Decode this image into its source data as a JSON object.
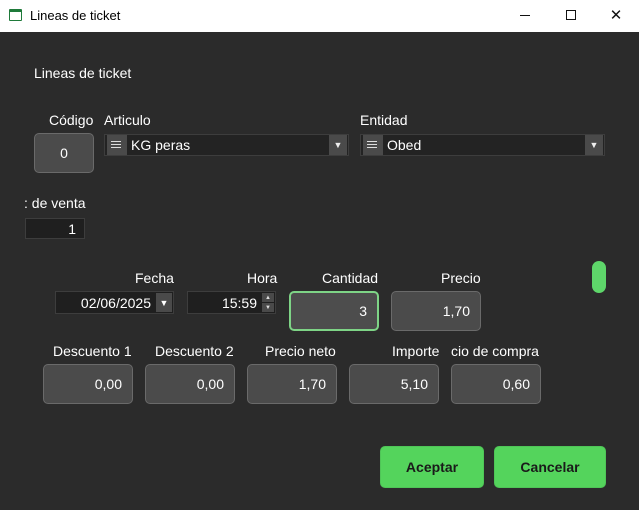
{
  "window": {
    "title": "Lineas de ticket",
    "icon": "window-icon",
    "controls": {
      "minimize": "minimize-icon",
      "maximize": "maximize-icon",
      "close": "close-icon"
    }
  },
  "section_title": "Lineas de ticket",
  "codigo": {
    "label": "Código",
    "value": "0"
  },
  "articulo": {
    "label": "Articulo",
    "value": "KG peras"
  },
  "entidad": {
    "label": "Entidad",
    "value": "Obed"
  },
  "tarifa": {
    "label": ": de venta",
    "value": "1"
  },
  "fecha": {
    "label": "Fecha",
    "value": "02/06/2025"
  },
  "hora": {
    "label": "Hora",
    "value": "15:59"
  },
  "cantidad": {
    "label": "Cantidad",
    "value": "3"
  },
  "precio": {
    "label": "Precio",
    "value": "1,70"
  },
  "descuento1": {
    "label": "Descuento 1",
    "value": "0,00"
  },
  "descuento2": {
    "label": "Descuento 2",
    "value": "0,00"
  },
  "precio_neto": {
    "label": "Precio neto",
    "value": "1,70"
  },
  "importe": {
    "label": "Importe",
    "value": "5,10"
  },
  "precio_compra": {
    "label": "cio de compra",
    "value": "0,60"
  },
  "buttons": {
    "accept": "Aceptar",
    "cancel": "Cancelar"
  },
  "colors": {
    "accent": "#54d45c",
    "focus_border": "#7ed486",
    "background": "#2b2b2b"
  }
}
